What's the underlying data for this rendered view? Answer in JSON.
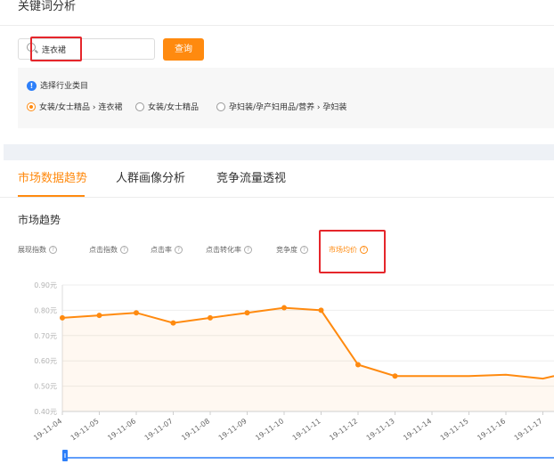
{
  "page": {
    "title": "关键词分析",
    "search": {
      "value": "连衣裙"
    },
    "query_button": "查询",
    "category": {
      "label": "选择行业类目",
      "options": [
        {
          "label": "女装/女士精品 › 连衣裙",
          "selected": true
        },
        {
          "label": "女装/女士精品",
          "selected": false
        },
        {
          "label": "孕妇装/孕产妇用品/营养 › 孕妇装",
          "selected": false
        }
      ]
    }
  },
  "tabs": [
    "市场数据趋势",
    "人群画像分析",
    "竞争流量透视"
  ],
  "active_tab": 0,
  "section_title": "市场趋势",
  "metrics": [
    "展现指数",
    "点击指数",
    "点击率",
    "点击转化率",
    "竞争度",
    "市场均价"
  ],
  "active_metric": 5,
  "colors": {
    "accent": "#ff8a0f",
    "highlight": "#e5262b",
    "info": "#2d7ff9"
  },
  "chart_data": {
    "type": "line",
    "x": [
      "19-11-04",
      "19-11-05",
      "19-11-06",
      "19-11-07",
      "19-11-08",
      "19-11-09",
      "19-11-10",
      "19-11-11",
      "19-11-12",
      "19-11-13",
      "19-11-14",
      "19-11-15",
      "19-11-16",
      "19-11-17"
    ],
    "y_ticks": [
      "0.90元",
      "0.80元",
      "0.70元",
      "0.60元",
      "0.50元",
      "0.40元"
    ],
    "ylim": [
      0.4,
      0.9
    ],
    "series": [
      {
        "values": [
          0.77,
          0.78,
          0.79,
          0.75,
          0.77,
          0.79,
          0.81,
          0.8,
          0.585,
          0.54,
          0.54,
          0.54,
          0.545,
          0.53
        ]
      }
    ],
    "grid": true
  }
}
